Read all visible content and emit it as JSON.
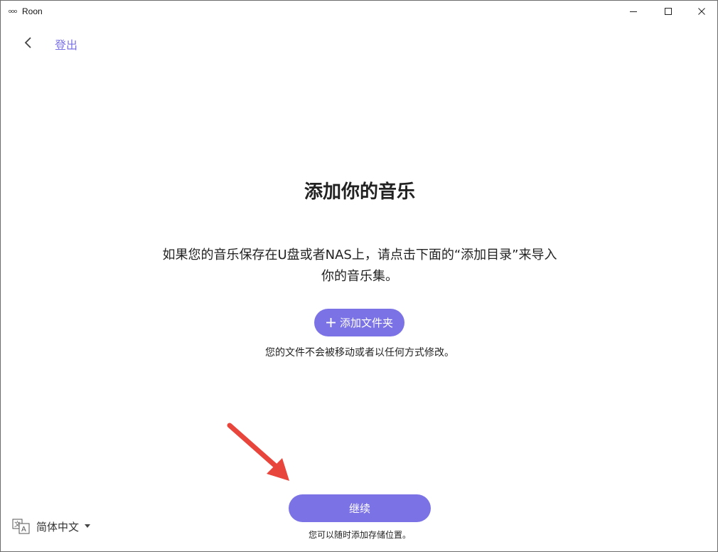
{
  "window": {
    "title": "Roon",
    "icon": "roon-logo-icon",
    "controls": [
      "minimize-icon",
      "maximize-icon",
      "close-icon"
    ]
  },
  "nav": {
    "back_icon": "chevron-left-icon",
    "logout_label": "登出"
  },
  "main": {
    "title": "添加你的音乐",
    "description_line1": "如果您的音乐保存在U盘或者NAS上，请点击下面的“添加目录”来导入",
    "description_line2": "你的音乐集。",
    "add_folder_label": "添加文件夹",
    "add_folder_icon": "plus-icon",
    "note": "您的文件不会被移动或者以任何方式修改。",
    "continue_label": "继续",
    "footnote": "您可以随时添加存储位置。"
  },
  "language": {
    "icon": "translate-icon",
    "selected": "简体中文",
    "caret_icon": "caret-down-icon"
  },
  "annotation": {
    "icon": "red-arrow-icon"
  },
  "colors": {
    "accent": "#7b72e6",
    "annotation_arrow": "#e8453c"
  }
}
